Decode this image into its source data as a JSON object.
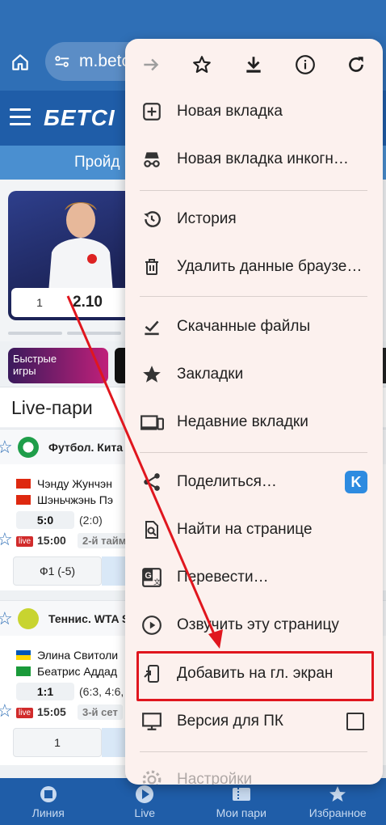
{
  "browser": {
    "url_text": "m.betc",
    "icons": {
      "home": "home-icon",
      "site_settings": "tune-icon"
    }
  },
  "site": {
    "logo_text": "БЕТСІ",
    "promo_text": "Пройд",
    "banner": {
      "odd_label": "1",
      "odd_value": "2.10"
    },
    "tiles": {
      "fast_games": "Быстрые\nигры"
    },
    "live_title": "Live-пари",
    "sections": [
      {
        "sport": "Футбол. Кита",
        "match": {
          "team1": "Чэнду Жунчэн",
          "team2": "Шэньчжэнь Пэ",
          "score": "5:0",
          "detail": "(2:0)",
          "live_badge": "live",
          "time": "15:00",
          "period": "2-й тайм",
          "bet_label": "Ф1 (-5)"
        }
      },
      {
        "sport": "Теннис. WTA S",
        "match": {
          "team1": "Элина Свитоли",
          "team2": "Беатрис Аддад",
          "score": "1:1",
          "detail": "(6:3, 4:6,",
          "live_badge": "live",
          "time": "15:05",
          "period": "3-й сет",
          "bet_label": "1"
        }
      }
    ]
  },
  "bottom_nav": [
    {
      "label": "Линия",
      "icon": "line-icon"
    },
    {
      "label": "Live",
      "icon": "play-icon"
    },
    {
      "label": "Мои пари",
      "icon": "ticket-icon"
    },
    {
      "label": "Избранное",
      "icon": "star-icon"
    }
  ],
  "menu": {
    "toolbar": [
      "forward-icon",
      "bookmark-star-icon",
      "download-icon",
      "info-icon",
      "reload-icon"
    ],
    "items": [
      {
        "label": "Новая вкладка",
        "icon": "new-tab-icon"
      },
      {
        "label": "Новая вкладка инкогн…",
        "icon": "incognito-icon"
      },
      {
        "label": "История",
        "icon": "history-icon"
      },
      {
        "label": "Удалить данные браузе…",
        "icon": "trash-icon"
      },
      {
        "label": "Скачанные файлы",
        "icon": "downloads-icon"
      },
      {
        "label": "Закладки",
        "icon": "star-icon"
      },
      {
        "label": "Недавние вкладки",
        "icon": "devices-icon"
      },
      {
        "label": "Поделиться…",
        "icon": "share-icon",
        "badge": "K"
      },
      {
        "label": "Найти на странице",
        "icon": "find-in-page-icon"
      },
      {
        "label": "Перевести…",
        "icon": "translate-icon"
      },
      {
        "label": "Озвучить эту страницу",
        "icon": "read-aloud-icon"
      },
      {
        "label": "Добавить на гл. экран",
        "icon": "add-to-home-icon"
      },
      {
        "label": "Версия для ПК",
        "icon": "desktop-icon",
        "checked": false
      },
      {
        "label": "Настройки",
        "icon": "settings-icon"
      }
    ]
  },
  "colors": {
    "accent": "#2f6fb6",
    "highlight": "#e0161e",
    "menu_bg": "#fcf1ee"
  }
}
